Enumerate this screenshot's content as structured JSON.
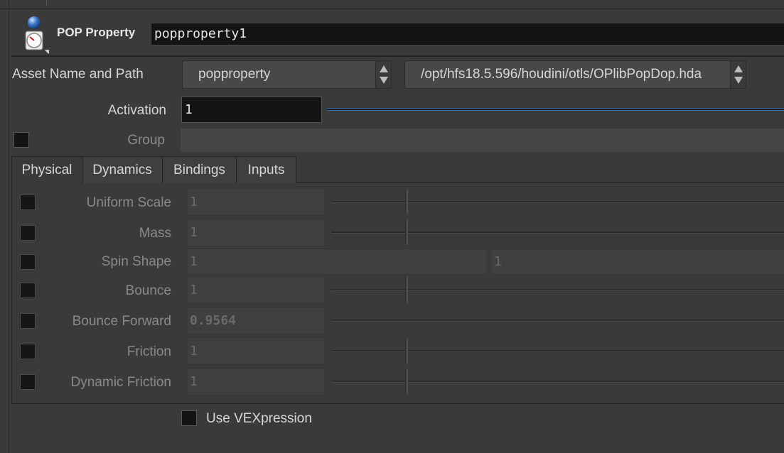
{
  "header": {
    "node_type": "POP Property",
    "node_name": "popproperty1"
  },
  "asset": {
    "label": "Asset Name and Path",
    "name": "popproperty",
    "path": "/opt/hfs18.5.596/houdini/otls/OPlibPopDop.hda"
  },
  "activation": {
    "label": "Activation",
    "value": "1"
  },
  "group": {
    "label": "Group",
    "value": ""
  },
  "tabs": [
    {
      "label": "Physical"
    },
    {
      "label": "Dynamics"
    },
    {
      "label": "Bindings"
    },
    {
      "label": "Inputs"
    }
  ],
  "physical": {
    "uniform_scale": {
      "label": "Uniform Scale",
      "value": "1"
    },
    "mass": {
      "label": "Mass",
      "value": "1"
    },
    "spin_shape": {
      "label": "Spin Shape",
      "value1": "1",
      "value2": "1"
    },
    "bounce": {
      "label": "Bounce",
      "value": "1"
    },
    "bounce_forward": {
      "label": "Bounce Forward",
      "value": "0.9564"
    },
    "friction": {
      "label": "Friction",
      "value": "1"
    },
    "dynamic_friction": {
      "label": "Dynamic Friction",
      "value": "1"
    }
  },
  "vexpression": {
    "label": "Use VEXpression"
  },
  "colors": {
    "background": "#3a3a3a",
    "field": "#141414",
    "accent": "#3c6fa8"
  }
}
